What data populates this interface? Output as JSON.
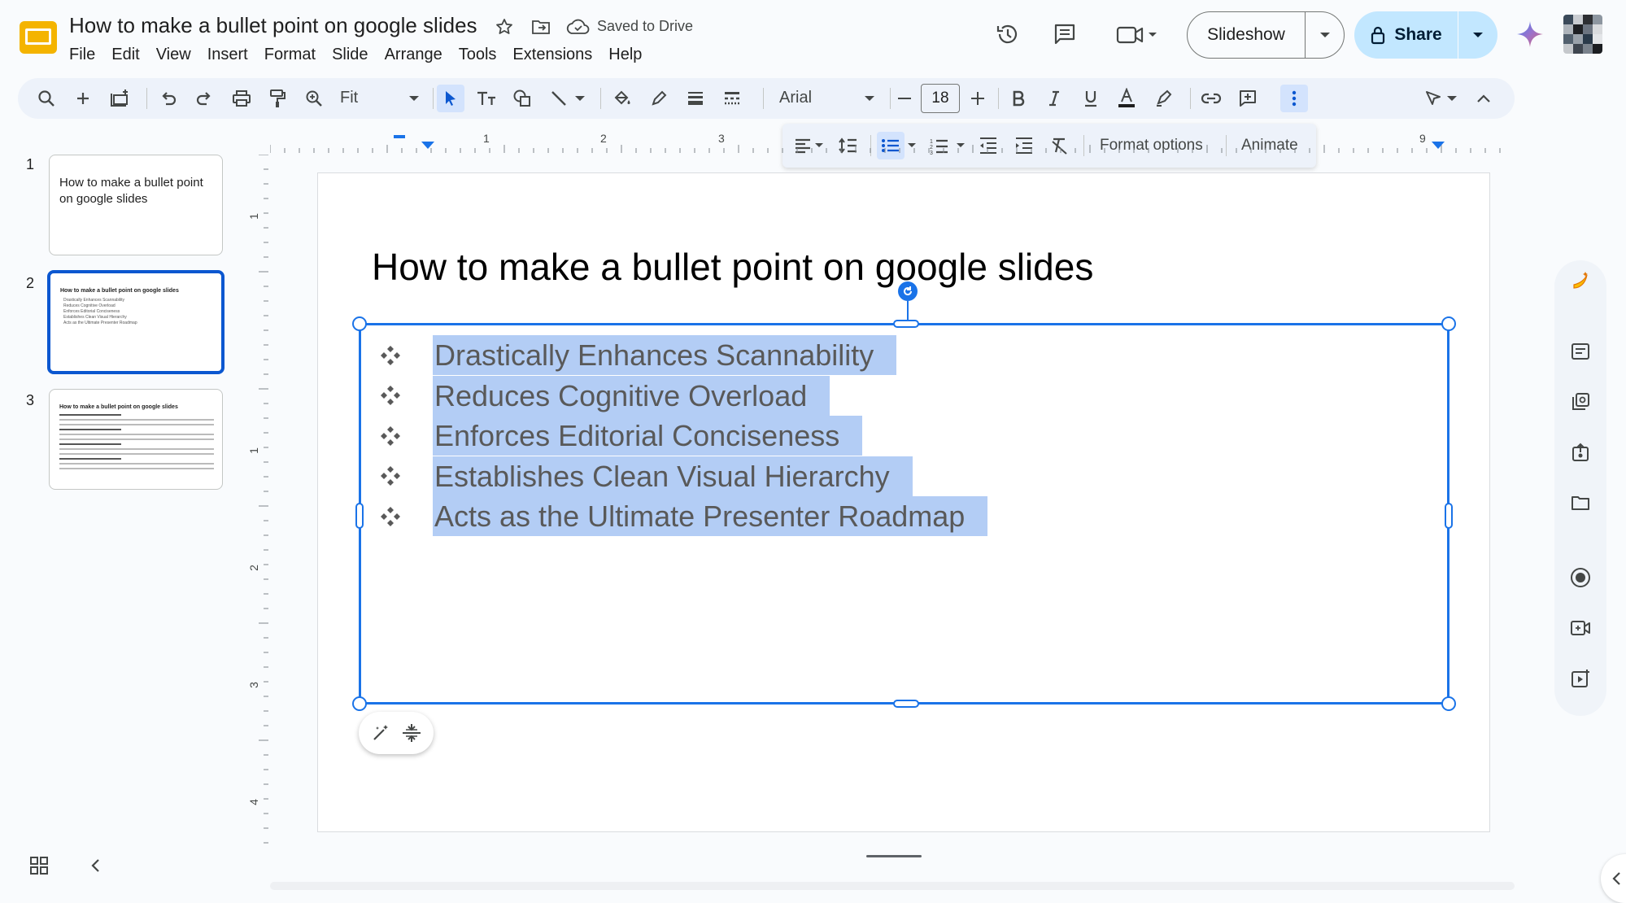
{
  "app": {
    "title": "How to make a bullet point on google slides",
    "save_status": "Saved to Drive",
    "icons": [
      "slides-logo-icon",
      "star-icon",
      "move-to-folder-icon",
      "cloud-saved-icon"
    ]
  },
  "menu": [
    "File",
    "Edit",
    "View",
    "Insert",
    "Format",
    "Slide",
    "Arrange",
    "Tools",
    "Extensions",
    "Help"
  ],
  "header_actions": {
    "slideshow_label": "Slideshow",
    "share_label": "Share",
    "icons": [
      "history-icon",
      "comments-icon",
      "meet-icon",
      "gemini-icon",
      "avatar"
    ]
  },
  "toolbar": {
    "zoom_value": "Fit",
    "font_name": "Arial",
    "font_size": "18"
  },
  "float_bar": {
    "format_options_label": "Format options",
    "animate_label": "Animate"
  },
  "ruler": {
    "h_numbers": [
      "1",
      "2",
      "3",
      "9"
    ],
    "v_numbers": [
      "1",
      "1",
      "2",
      "3",
      "4"
    ]
  },
  "filmstrip": {
    "slides": [
      {
        "number": "1",
        "title": "How to make a bullet point on google slides"
      },
      {
        "number": "2",
        "title": "How to make a bullet point on google slides",
        "bullets": [
          "Drastically Enhances Scannability",
          "Reduces Cognitive Overload",
          "Enforces Editorial Conciseness",
          "Establishes Clean Visual Hierarchy",
          "Acts as the Ultimate Presenter Roadmap"
        ]
      },
      {
        "number": "3",
        "title": "How to make a bullet point on google slides"
      }
    ]
  },
  "slide": {
    "title": "How to make a bullet point on google slides",
    "bullets": [
      "Drastically Enhances Scannability",
      "Reduces Cognitive Overload",
      "Enforces Editorial Conciseness",
      "Establishes Clean Visual Hierarchy",
      "Acts as the Ultimate Presenter Roadmap"
    ]
  },
  "colors": {
    "accent": "#1a73e8",
    "selection": "#b3cdf5",
    "share_bg": "#c2e7ff",
    "toolbar_bg": "#edf2fa"
  }
}
